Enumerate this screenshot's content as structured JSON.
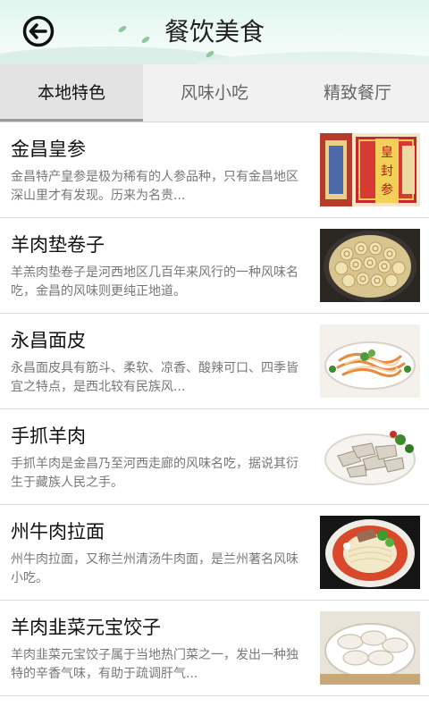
{
  "header": {
    "title": "餐饮美食",
    "back_icon": "back-arrow-icon"
  },
  "tabs": [
    {
      "label": "本地特色",
      "active": true
    },
    {
      "label": "风味小吃",
      "active": false
    },
    {
      "label": "精致餐厅",
      "active": false
    }
  ],
  "items": [
    {
      "name": "金昌皇参",
      "desc": "金昌特产皇参是极为稀有的人参品种，只有金昌地区深山里才有发现。历来为名贵...",
      "image": "huangshen-gift-box-photo",
      "image_text": "皇封参"
    },
    {
      "name": "羊肉垫卷子",
      "desc": "羊羔肉垫卷子是河西地区几百年来风行的一种风味名吃，金昌的风味则更纯正地道。",
      "image": "rolled-pastry-pan-photo"
    },
    {
      "name": "永昌面皮",
      "desc": "永昌面皮具有筋斗、柔软、凉香、酸辣可口、四季皆宜之特点，是西北较有民族风...",
      "image": "cold-noodles-plate-photo"
    },
    {
      "name": "手抓羊肉",
      "desc": "手抓羊肉是金昌乃至河西走廊的风味名吃，据说其衍生于藏族人民之手。",
      "image": "hand-pulled-mutton-photo"
    },
    {
      "name": "州牛肉拉面",
      "desc": "州牛肉拉面，又称兰州清汤牛肉面，是兰州著名风味小吃。",
      "image": "beef-noodle-bowl-photo"
    },
    {
      "name": "羊肉韭菜元宝饺子",
      "desc": "羊肉韭菜元宝饺子属于当地热门菜之一，发出一种独特的辛香气味，有助于疏调肝气...",
      "image": "dumplings-plate-photo"
    }
  ]
}
